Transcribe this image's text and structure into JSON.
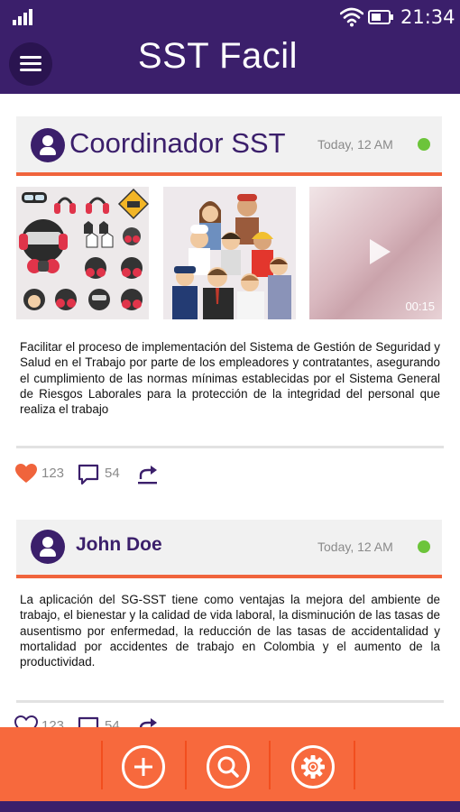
{
  "status_bar": {
    "time": "21:34"
  },
  "header": {
    "title": "SST Facil",
    "menu_icon": "hamburger-menu-icon"
  },
  "posts": [
    {
      "author": "Coordinador SST",
      "timestamp": "Today, 12 AM",
      "online_color": "#6cc43a",
      "media": [
        {
          "type": "image",
          "depicts": "safety-equipment-icons"
        },
        {
          "type": "image",
          "depicts": "workers-group"
        },
        {
          "type": "video",
          "duration": "00:15"
        }
      ],
      "text": "Facilitar el proceso de implementación del Sistema de Gestión de Seguridad y Salud en el Trabajo por parte de los empleadores y contratantes, asegurando el cumplimiento de las normas mínimas establecidas por el Sistema General de Riesgos Laborales para la protección de la integridad del personal que realiza el trabajo",
      "likes": "123",
      "comments": "54"
    },
    {
      "author": "John Doe",
      "timestamp": "Today, 12 AM",
      "online_color": "#6cc43a",
      "text": "La aplicación del SG-SST tiene como ventajas la mejora del ambiente de trabajo, el bienestar y la calidad de vida laboral, la disminución de las tasas de ausentismo por enfermedad, la reducción de las tasas de accidentalidad y mortalidad por accidentes de trabajo en Colombia y el aumento de la productividad.",
      "likes": "123",
      "comments": "54"
    }
  ],
  "bottom_nav": [
    {
      "name": "add",
      "icon": "plus-icon"
    },
    {
      "name": "search",
      "icon": "search-icon"
    },
    {
      "name": "settings",
      "icon": "gear-icon"
    }
  ],
  "colors": {
    "primary": "#3b1f6b",
    "accent": "#f7693d",
    "like": "#f0643c",
    "online": "#6cc43a"
  }
}
